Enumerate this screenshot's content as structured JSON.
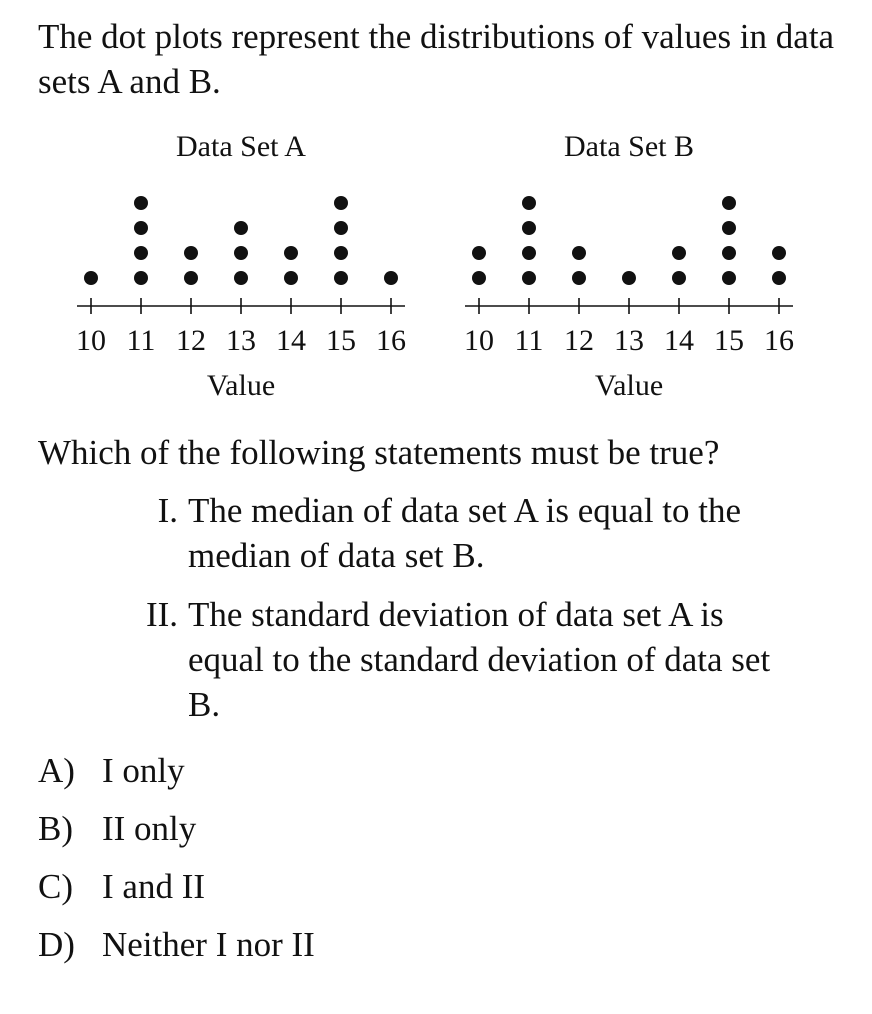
{
  "stem": "The dot plots represent the distributions of values in data sets A and B.",
  "question": "Which of the following statements must be true?",
  "statements": [
    {
      "numeral": "I.",
      "text": "The median of data set A is equal to the median of data set B."
    },
    {
      "numeral": "II.",
      "text": "The standard deviation of data set A is equal to the standard deviation of data set B."
    }
  ],
  "choices": [
    {
      "letter": "A)",
      "text": "I only"
    },
    {
      "letter": "B)",
      "text": "II only"
    },
    {
      "letter": "C)",
      "text": "I and II"
    },
    {
      "letter": "D)",
      "text": "Neither I nor II"
    }
  ],
  "chart_data": [
    {
      "type": "dot",
      "title": "Data Set A",
      "xlabel": "Value",
      "ticks": [
        10,
        11,
        12,
        13,
        14,
        15,
        16
      ],
      "x": [
        10,
        11,
        12,
        13,
        14,
        15,
        16
      ],
      "counts": [
        1,
        4,
        2,
        3,
        2,
        4,
        1
      ]
    },
    {
      "type": "dot",
      "title": "Data Set B",
      "xlabel": "Value",
      "ticks": [
        10,
        11,
        12,
        13,
        14,
        15,
        16
      ],
      "x": [
        10,
        11,
        12,
        13,
        14,
        15,
        16
      ],
      "counts": [
        2,
        4,
        2,
        1,
        2,
        4,
        2
      ]
    }
  ]
}
